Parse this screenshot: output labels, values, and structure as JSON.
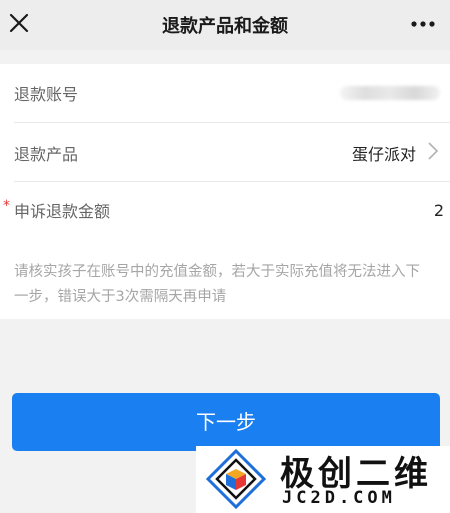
{
  "header": {
    "title": "退款产品和金额",
    "close_icon": "close-icon",
    "more_icon": "more-icon"
  },
  "form": {
    "account": {
      "label": "退款账号",
      "value_masked": true
    },
    "product": {
      "label": "退款产品",
      "value": "蛋仔派对",
      "icon": "chevron-right-icon"
    },
    "amount": {
      "required_mark": "*",
      "label": "申诉退款金额",
      "value": "2"
    },
    "notice": "请核实孩子在账号中的充值金额，若大于实际充值将无法进入下一步，错误大于3次需隔天再申请"
  },
  "next_button": {
    "label": "下一步"
  },
  "watermark": {
    "name": "极创二维",
    "url": "JC2D.COM"
  },
  "colors": {
    "primary": "#1a7ff0",
    "required": "#e53935",
    "navbar_bg": "#ededed",
    "page_bg": "#f2f2f2"
  }
}
